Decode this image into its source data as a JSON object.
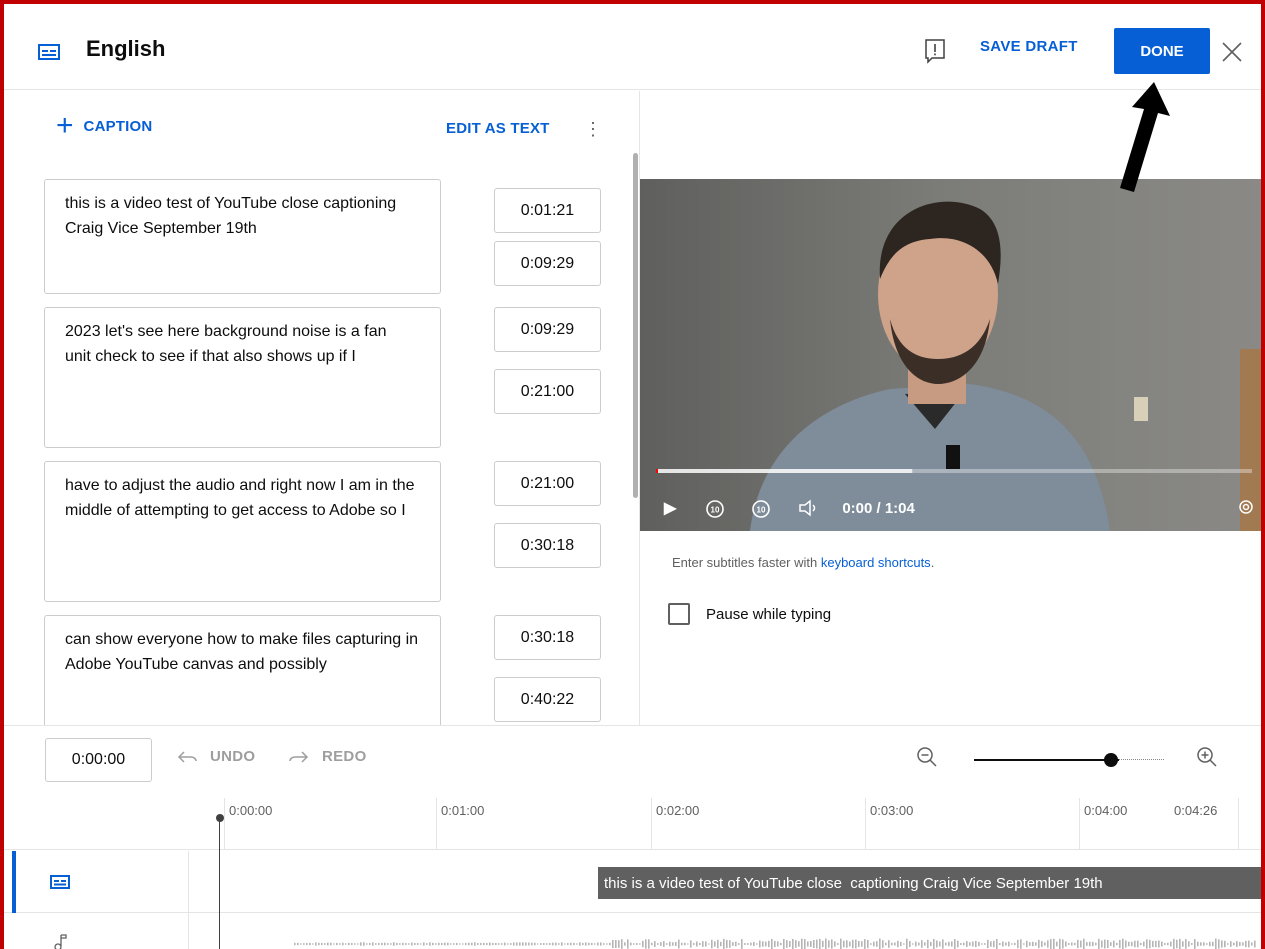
{
  "header": {
    "title": "English",
    "save_draft_label": "SAVE DRAFT",
    "done_label": "DONE"
  },
  "toolbar": {
    "add_caption_label": "CAPTION",
    "edit_as_text_label": "EDIT AS TEXT"
  },
  "captions": [
    {
      "text": "this is a video test of YouTube close captioning Craig Vice September 19th",
      "start": "0:01:21",
      "end": "0:09:29"
    },
    {
      "text": "2023 let's see here background noise is a fan\nunit check to see if that also shows up if I",
      "start": "0:09:29",
      "end": "0:21:00"
    },
    {
      "text": "have to adjust the audio and right now I am in the\nmiddle of attempting to get access to Adobe so I",
      "start": "0:21:00",
      "end": "0:30:18"
    },
    {
      "text": "can show everyone how to make files capturing in\nAdobe YouTube canvas and possibly",
      "start": "0:30:18",
      "end": "0:40:22"
    }
  ],
  "player": {
    "time_display": "0:00 / 1:04",
    "progress_fraction": 0.43
  },
  "hint": {
    "prefix": "Enter subtitles faster with ",
    "link": "keyboard shortcuts",
    "suffix": "."
  },
  "pause_while_typing": {
    "label": "Pause while typing",
    "checked": false
  },
  "timeline": {
    "current_time": "0:00:00",
    "undo_label": "UNDO",
    "redo_label": "REDO",
    "zoom_level_fraction": 0.72,
    "ticks": [
      "0:00:00",
      "0:01:00",
      "0:02:00",
      "0:03:00",
      "0:04:00",
      "0:04:26"
    ],
    "caption_block_text": "this is a video test of YouTube close  captioning Craig Vice September 19th"
  },
  "colors": {
    "accent": "#065fd4",
    "frame": "#c00000",
    "caption_block": "#606060"
  },
  "icons": {
    "header": "subtitles-icon",
    "feedback": "feedback-icon",
    "close": "close-icon",
    "zoom_out": "zoom-out-icon",
    "zoom_in": "zoom-in-icon",
    "audio_track": "music-note-icon"
  }
}
